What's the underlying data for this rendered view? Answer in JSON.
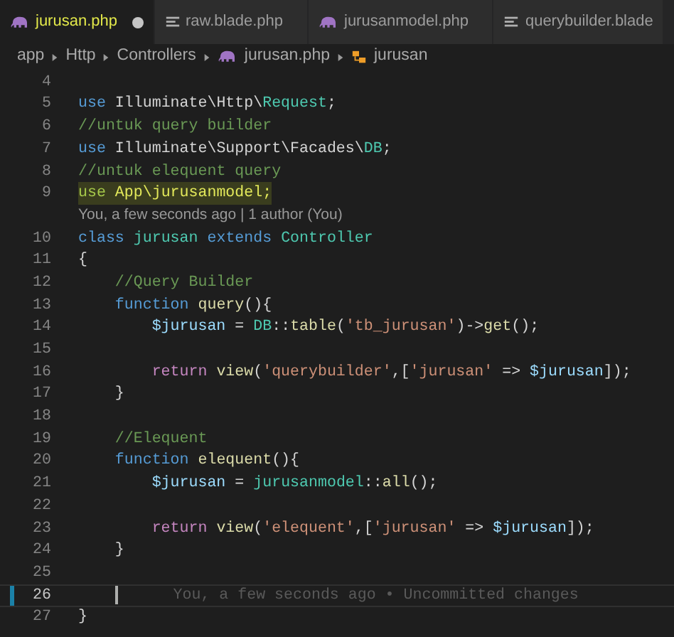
{
  "tabs": [
    {
      "label": "jurusan.php",
      "kind": "php",
      "selected": true,
      "modified": true
    },
    {
      "label": "raw.blade.php",
      "kind": "blade",
      "selected": false,
      "modified": false
    },
    {
      "label": "jurusanmodel.php",
      "kind": "php",
      "selected": false,
      "modified": false
    },
    {
      "label": "querybuilder.blade",
      "kind": "blade",
      "selected": false,
      "modified": false
    }
  ],
  "breadcrumb": [
    {
      "label": "app",
      "kind": "folder"
    },
    {
      "label": "Http",
      "kind": "folder"
    },
    {
      "label": "Controllers",
      "kind": "folder"
    },
    {
      "label": "jurusan.php",
      "kind": "php"
    },
    {
      "label": "jurusan",
      "kind": "class"
    }
  ],
  "lines": [
    {
      "number": "4"
    },
    {
      "number": "5",
      "tokens": [
        {
          "t": "use ",
          "kind": "keyword"
        },
        {
          "t": "Illuminate\\Http\\",
          "kind": "plain"
        },
        {
          "t": "Request",
          "kind": "type"
        },
        {
          "t": ";",
          "kind": "plain"
        }
      ]
    },
    {
      "number": "6",
      "tokens": [
        {
          "t": "//untuk query builder",
          "kind": "comment"
        }
      ]
    },
    {
      "number": "7",
      "tokens": [
        {
          "t": "use ",
          "kind": "keyword"
        },
        {
          "t": "Illuminate\\Support\\Facades\\",
          "kind": "plain"
        },
        {
          "t": "DB",
          "kind": "type"
        },
        {
          "t": ";",
          "kind": "plain"
        }
      ]
    },
    {
      "number": "8",
      "tokens": [
        {
          "t": "//untuk elequent query",
          "kind": "comment"
        }
      ]
    },
    {
      "number": "9",
      "highlighted": true,
      "tokens": [
        {
          "t": "use ",
          "kind": "keyword"
        },
        {
          "t": "App\\jurusanmodel;",
          "kind": "plain"
        }
      ],
      "codelens": "You, a few seconds ago | 1 author (You)"
    },
    {
      "number": "10",
      "tokens": [
        {
          "t": "class ",
          "kind": "keyword"
        },
        {
          "t": "jurusan ",
          "kind": "type"
        },
        {
          "t": "extends ",
          "kind": "keyword"
        },
        {
          "t": "Controller",
          "kind": "type"
        }
      ]
    },
    {
      "number": "11",
      "tokens": [
        {
          "t": "{",
          "kind": "plain"
        }
      ]
    },
    {
      "number": "12",
      "tokens": [
        {
          "t": "    //Query Builder",
          "kind": "comment"
        }
      ]
    },
    {
      "number": "13",
      "tokens": [
        {
          "t": "    function ",
          "kind": "keyword"
        },
        {
          "t": "query",
          "kind": "function"
        },
        {
          "t": "(){",
          "kind": "plain"
        }
      ]
    },
    {
      "number": "14",
      "tokens": [
        {
          "t": "        $jurusan",
          "kind": "variable"
        },
        {
          "t": " = ",
          "kind": "plain"
        },
        {
          "t": "DB",
          "kind": "type"
        },
        {
          "t": "::",
          "kind": "plain"
        },
        {
          "t": "table",
          "kind": "function"
        },
        {
          "t": "(",
          "kind": "plain"
        },
        {
          "t": "'tb_jurusan'",
          "kind": "string"
        },
        {
          "t": ")->",
          "kind": "plain"
        },
        {
          "t": "get",
          "kind": "function"
        },
        {
          "t": "();",
          "kind": "plain"
        }
      ]
    },
    {
      "number": "15"
    },
    {
      "number": "16",
      "tokens": [
        {
          "t": "        return ",
          "kind": "control"
        },
        {
          "t": "view",
          "kind": "function"
        },
        {
          "t": "(",
          "kind": "plain"
        },
        {
          "t": "'querybuilder'",
          "kind": "string"
        },
        {
          "t": ",[",
          "kind": "plain"
        },
        {
          "t": "'jurusan'",
          "kind": "string"
        },
        {
          "t": " => ",
          "kind": "plain"
        },
        {
          "t": "$jurusan",
          "kind": "variable"
        },
        {
          "t": "]);",
          "kind": "plain"
        }
      ]
    },
    {
      "number": "17",
      "tokens": [
        {
          "t": "    }",
          "kind": "plain"
        }
      ]
    },
    {
      "number": "18"
    },
    {
      "number": "19",
      "tokens": [
        {
          "t": "    //Elequent",
          "kind": "comment"
        }
      ]
    },
    {
      "number": "20",
      "tokens": [
        {
          "t": "    function ",
          "kind": "keyword"
        },
        {
          "t": "elequent",
          "kind": "function"
        },
        {
          "t": "(){",
          "kind": "plain"
        }
      ]
    },
    {
      "number": "21",
      "tokens": [
        {
          "t": "        $jurusan",
          "kind": "variable"
        },
        {
          "t": " = ",
          "kind": "plain"
        },
        {
          "t": "jurusanmodel",
          "kind": "type"
        },
        {
          "t": "::",
          "kind": "plain"
        },
        {
          "t": "all",
          "kind": "function"
        },
        {
          "t": "();",
          "kind": "plain"
        }
      ]
    },
    {
      "number": "22"
    },
    {
      "number": "23",
      "tokens": [
        {
          "t": "        return ",
          "kind": "control"
        },
        {
          "t": "view",
          "kind": "function"
        },
        {
          "t": "(",
          "kind": "plain"
        },
        {
          "t": "'elequent'",
          "kind": "string"
        },
        {
          "t": ",[",
          "kind": "plain"
        },
        {
          "t": "'jurusan'",
          "kind": "string"
        },
        {
          "t": " => ",
          "kind": "plain"
        },
        {
          "t": "$jurusan",
          "kind": "variable"
        },
        {
          "t": "]);",
          "kind": "plain"
        }
      ]
    },
    {
      "number": "24",
      "tokens": [
        {
          "t": "    }",
          "kind": "plain"
        }
      ]
    },
    {
      "number": "25"
    },
    {
      "number": "26",
      "current": true,
      "modified": true,
      "blame": "You, a few seconds ago • Uncommitted changes"
    },
    {
      "number": "27",
      "tokens": [
        {
          "t": "}",
          "kind": "plain"
        }
      ]
    }
  ]
}
